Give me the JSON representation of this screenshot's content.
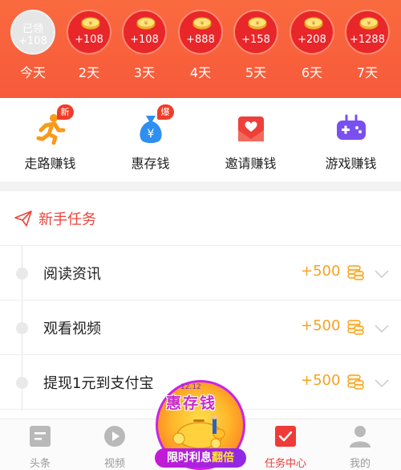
{
  "checkin": {
    "days": [
      {
        "status": "已领",
        "amount": "+108",
        "label": "今天",
        "claimed": true
      },
      {
        "amount": "+108",
        "label": "2天",
        "claimed": false
      },
      {
        "amount": "+108",
        "label": "3天",
        "claimed": false
      },
      {
        "amount": "+888",
        "label": "4天",
        "claimed": false
      },
      {
        "amount": "+158",
        "label": "5天",
        "claimed": false
      },
      {
        "amount": "+208",
        "label": "6天",
        "claimed": false
      },
      {
        "amount": "+1288",
        "label": "7天",
        "claimed": false
      }
    ]
  },
  "quick_actions": [
    {
      "label": "走路赚钱",
      "badge": "新",
      "icon": "running-person-icon",
      "color": "#f89a1c"
    },
    {
      "label": "惠存钱",
      "badge": "爆",
      "icon": "money-bag-icon",
      "color": "#2e8ff0"
    },
    {
      "label": "邀请赚钱",
      "badge": "",
      "icon": "invite-envelope-icon",
      "color": "#ef3f3a"
    },
    {
      "label": "游戏赚钱",
      "badge": "",
      "icon": "gamepad-icon",
      "color": "#7a4ff0"
    }
  ],
  "tasks_section": {
    "title": "新手任务",
    "icon": "paper-plane-icon",
    "items": [
      {
        "name": "阅读资讯",
        "reward": "+500"
      },
      {
        "name": "观看视频",
        "reward": "+500"
      },
      {
        "name": "提现1元到支付宝",
        "reward": "+500"
      }
    ]
  },
  "promo": {
    "date": "12.12",
    "title": "惠存钱",
    "ribbon_prefix": "限时利息",
    "ribbon_highlight": "翻倍"
  },
  "tabbar": {
    "tabs": [
      {
        "label": "头条",
        "icon": "news-icon",
        "active": false
      },
      {
        "label": "视频",
        "icon": "play-icon",
        "active": false
      },
      {
        "label": "任务中心",
        "icon": "task-check-icon",
        "active": true
      },
      {
        "label": "我的",
        "icon": "user-icon",
        "active": false
      }
    ]
  },
  "colors": {
    "header": "#f65a3a",
    "accent_red": "#ef3b37",
    "reward_orange": "#f6a223"
  }
}
